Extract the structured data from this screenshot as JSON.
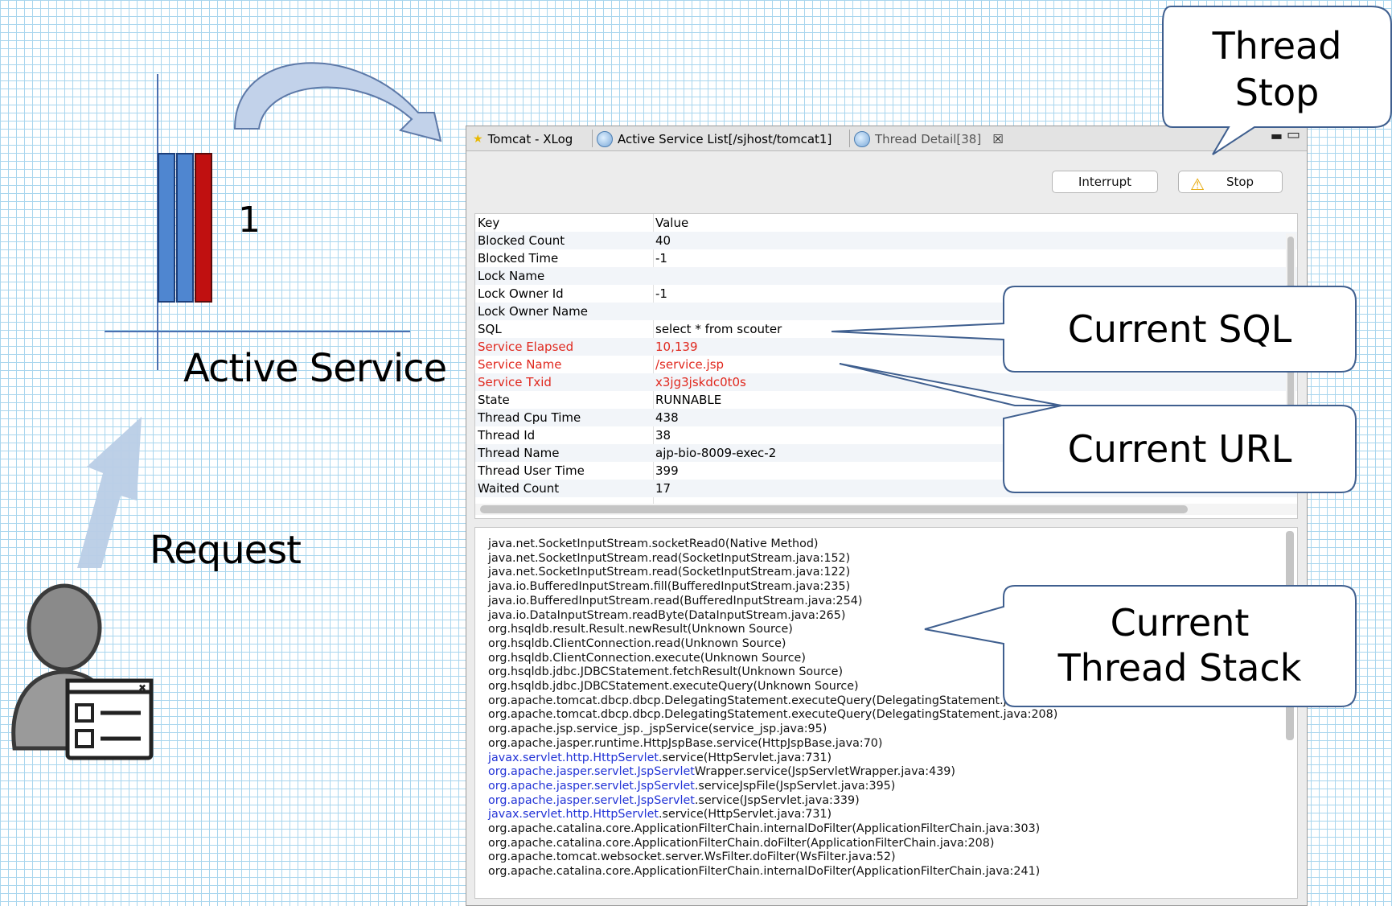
{
  "diagram": {
    "active_count": "1",
    "active_service_label": "Active Service",
    "request_label": "Request",
    "colors": {
      "bar_blue": "#4f86d0",
      "bar_red": "#c01010",
      "arrow": "#b9cde6"
    }
  },
  "callouts": {
    "thread_stop": "Thread\nStop",
    "current_sql": "Current SQL",
    "current_url": "Current URL",
    "current_thread_stack": "Current\nThread Stack"
  },
  "window": {
    "tabs": [
      {
        "label": "Tomcat - XLog",
        "icon": "star-icon"
      },
      {
        "label": "Active Service List[/sjhost/tomcat1]",
        "icon": "globe-icon"
      },
      {
        "label": "Thread Detail[38]",
        "icon": "globe-icon"
      }
    ],
    "interrupt_label": "Interrupt",
    "stop_label": "Stop",
    "table": {
      "headers": [
        "Key",
        "Value"
      ],
      "rows": [
        {
          "key": "Blocked Count",
          "value": "40"
        },
        {
          "key": "Blocked Time",
          "value": "-1"
        },
        {
          "key": "Lock Name",
          "value": ""
        },
        {
          "key": "Lock Owner Id",
          "value": "-1"
        },
        {
          "key": "Lock Owner Name",
          "value": ""
        },
        {
          "key": "SQL",
          "value": "select * from scouter"
        },
        {
          "key": "Service Elapsed",
          "value": "10,139"
        },
        {
          "key": "Service Name",
          "value": "/service.jsp"
        },
        {
          "key": "Service Txid",
          "value": "x3jg3jskdc0t0s"
        },
        {
          "key": "State",
          "value": "RUNNABLE"
        },
        {
          "key": "Thread Cpu Time",
          "value": "438"
        },
        {
          "key": "Thread Id",
          "value": "38"
        },
        {
          "key": "Thread Name",
          "value": "ajp-bio-8009-exec-2"
        },
        {
          "key": "Thread User Time",
          "value": "399"
        },
        {
          "key": "Waited Count",
          "value": "17"
        }
      ]
    },
    "stack": [
      {
        "text": "java.net.SocketInputStream.socketRead0(Native Method)"
      },
      {
        "text": "java.net.SocketInputStream.read(SocketInputStream.java:152)"
      },
      {
        "text": "java.net.SocketInputStream.read(SocketInputStream.java:122)"
      },
      {
        "text": "java.io.BufferedInputStream.fill(BufferedInputStream.java:235)"
      },
      {
        "text": "java.io.BufferedInputStream.read(BufferedInputStream.java:254)"
      },
      {
        "text": "java.io.DataInputStream.readByte(DataInputStream.java:265)"
      },
      {
        "text": "org.hsqldb.result.Result.newResult(Unknown Source)"
      },
      {
        "text": "org.hsqldb.ClientConnection.read(Unknown Source)"
      },
      {
        "text": "org.hsqldb.ClientConnection.execute(Unknown Source)"
      },
      {
        "text": "org.hsqldb.jdbc.JDBCStatement.fetchResult(Unknown Source)"
      },
      {
        "text": "org.hsqldb.jdbc.JDBCStatement.executeQuery(Unknown Source)"
      },
      {
        "text": "org.apache.tomcat.dbcp.dbcp.DelegatingStatement.executeQuery(DelegatingStatement.java:208)"
      },
      {
        "text": "org.apache.tomcat.dbcp.dbcp.DelegatingStatement.executeQuery(DelegatingStatement.java:208)"
      },
      {
        "text": "org.apache.jsp.service_jsp._jspService(service_jsp.java:95)"
      },
      {
        "text": "org.apache.jasper.runtime.HttpJspBase.service(HttpJspBase.java:70)"
      },
      {
        "link": "javax.servlet.http.HttpServlet",
        "text": ".service(HttpServlet.java:731)"
      },
      {
        "link": "org.apache.jasper.servlet.JspServlet",
        "text": "Wrapper.service(JspServletWrapper.java:439)"
      },
      {
        "link": "org.apache.jasper.servlet.JspServlet",
        "text": ".serviceJspFile(JspServlet.java:395)"
      },
      {
        "link": "org.apache.jasper.servlet.JspServlet",
        "text": ".service(JspServlet.java:339)"
      },
      {
        "link": "javax.servlet.http.HttpServlet",
        "text": ".service(HttpServlet.java:731)"
      },
      {
        "text": "org.apache.catalina.core.ApplicationFilterChain.internalDoFilter(ApplicationFilterChain.java:303)"
      },
      {
        "text": "org.apache.catalina.core.ApplicationFilterChain.doFilter(ApplicationFilterChain.java:208)"
      },
      {
        "text": "org.apache.tomcat.websocket.server.WsFilter.doFilter(WsFilter.java:52)"
      },
      {
        "text": "org.apache.catalina.core.ApplicationFilterChain.internalDoFilter(ApplicationFilterChain.java:241)"
      }
    ]
  }
}
